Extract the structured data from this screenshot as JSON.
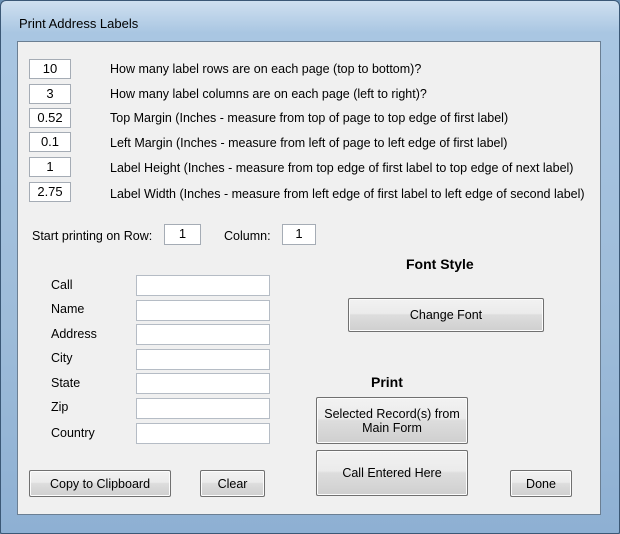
{
  "window": {
    "title": "Print Address Labels"
  },
  "settings": [
    {
      "value": "10",
      "label": "How many label rows are on each page (top to bottom)?"
    },
    {
      "value": "3",
      "label": "How many label columns are on each page (left to right)?"
    },
    {
      "value": "0.52",
      "label": "Top Margin (Inches - measure from top of page to top edge of first label)"
    },
    {
      "value": "0.1",
      "label": "Left Margin (Inches - measure from left of page to left edge of first label)"
    },
    {
      "value": "1",
      "label": "Label Height (Inches - measure from top edge of first label to top edge of next label)"
    },
    {
      "value": "2.75",
      "label": "Label Width (Inches - measure from left edge of first label to left edge of second label)"
    }
  ],
  "start": {
    "row_label": "Start printing on Row:",
    "row_value": "1",
    "column_label": "Column:",
    "column_value": "1"
  },
  "address_fields": [
    {
      "label": "Call",
      "value": ""
    },
    {
      "label": "Name",
      "value": ""
    },
    {
      "label": "Address",
      "value": ""
    },
    {
      "label": "City",
      "value": ""
    },
    {
      "label": "State",
      "value": ""
    },
    {
      "label": "Zip",
      "value": ""
    },
    {
      "label": "Country",
      "value": ""
    }
  ],
  "font_style": {
    "heading": "Font Style",
    "change_font_label": "Change Font"
  },
  "print": {
    "heading": "Print",
    "selected_records_line1": "Selected Record(s) from",
    "selected_records_line2": "Main Form",
    "call_entered_label": "Call Entered Here"
  },
  "buttons": {
    "copy_label": "Copy to Clipboard",
    "clear_label": "Clear",
    "done_label": "Done"
  }
}
